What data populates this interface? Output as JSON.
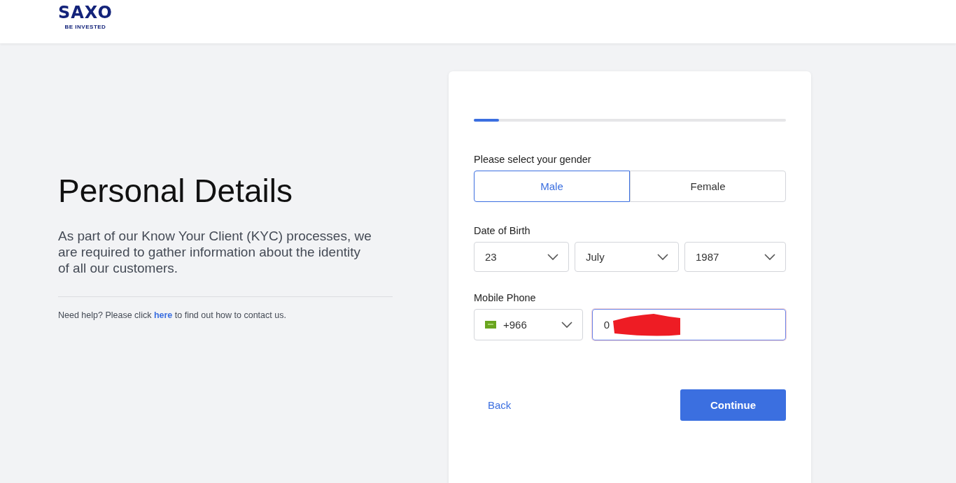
{
  "header": {
    "logo": "SAXO",
    "tagline": "BE INVESTED"
  },
  "intro": {
    "title": "Personal Details",
    "text": "As part of our Know Your Client (KYC) processes, we are required to gather information about the identity of all our customers.",
    "help_before": "Need help? Please click ",
    "help_link": "here",
    "help_after": " to find out how to contact us."
  },
  "form": {
    "progress": {
      "level": 0.08
    },
    "gender": {
      "label": "Please select your gender",
      "options": [
        {
          "label": "Male",
          "selected": true
        },
        {
          "label": "Female",
          "selected": false
        }
      ]
    },
    "dob": {
      "label": "Date of Birth",
      "fields": [
        {
          "value": "23"
        },
        {
          "value": "July"
        },
        {
          "value": "1987"
        }
      ]
    },
    "phone": {
      "label": "Mobile Phone",
      "code": "+966",
      "value": "0",
      "redacted": true
    },
    "back": "Back",
    "continue": "Continue"
  }
}
